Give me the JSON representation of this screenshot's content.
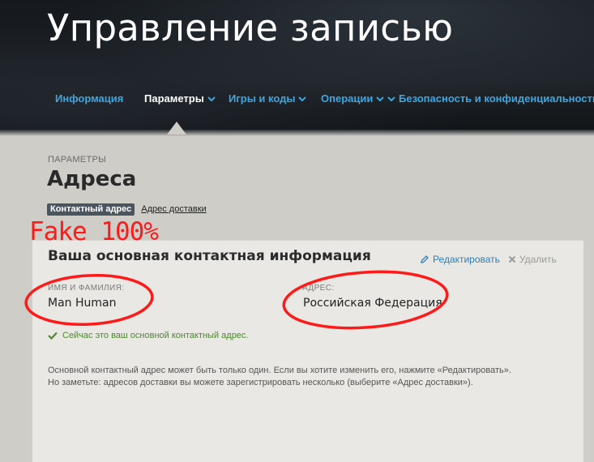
{
  "header": {
    "title": "Управление записью",
    "nav": [
      {
        "label": "Информация",
        "active": false,
        "has_menu": false
      },
      {
        "label": "Параметры",
        "active": true,
        "has_menu": true
      },
      {
        "label": "Игры и коды",
        "active": false,
        "has_menu": true
      },
      {
        "label": "Операции",
        "active": false,
        "has_menu": true
      },
      {
        "label": "Безопасность и конфиденциальность",
        "active": false,
        "has_menu": false
      }
    ]
  },
  "page": {
    "breadcrumb": "ПАРАМЕТРЫ",
    "title": "Адреса",
    "subtabs": [
      {
        "label": "Контактный адрес",
        "active": true
      },
      {
        "label": "Адрес доставки",
        "active": false
      }
    ]
  },
  "annotation": {
    "label": "Fake 100%",
    "color": "#ff1a1a"
  },
  "card": {
    "heading": "Ваша основная контактная информация",
    "edit_label": "Редактировать",
    "delete_label": "Удалить",
    "name_label": "ИМЯ И ФАМИЛИЯ:",
    "name_value": "Man Human",
    "address_label": "АДРЕС:",
    "address_value": "Российская Федерация",
    "status": "Сейчас это ваш основной контактный адрес.",
    "note_line1": "Основной контактный адрес может быть только один. Если вы хотите изменить его, нажмите «Редактировать».",
    "note_line2": "Но заметьте: адресов доставки вы можете зарегистрировать несколько (выберите «Адрес доставки»)."
  },
  "colors": {
    "link": "#3fa6e0",
    "success": "#4a8a2a",
    "edit": "#2f7fb8"
  }
}
